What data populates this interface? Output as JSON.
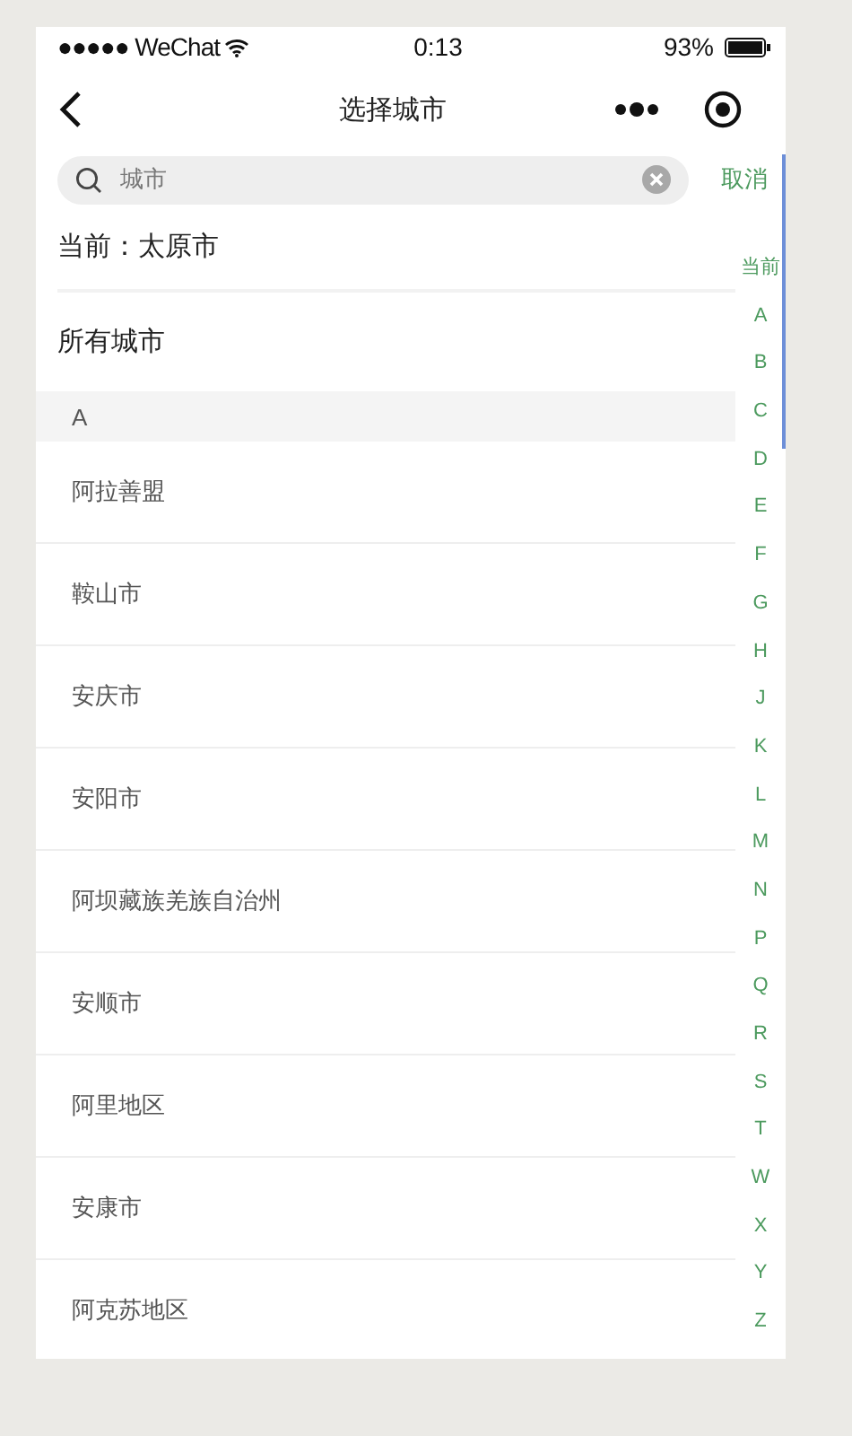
{
  "status_bar": {
    "carrier": "●●●●● WeChat",
    "time": "0:13",
    "battery": "93%"
  },
  "nav": {
    "title": "选择城市"
  },
  "search": {
    "value": "城市",
    "cancel": "取消"
  },
  "current": {
    "label": "当前：太原市"
  },
  "all_cities": {
    "label": "所有城市"
  },
  "sections": [
    {
      "letter": "A",
      "cities": [
        "阿拉善盟",
        "鞍山市",
        "安庆市",
        "安阳市",
        "阿坝藏族羌族自治州",
        "安顺市",
        "阿里地区",
        "安康市",
        "阿克苏地区"
      ]
    }
  ],
  "index": [
    "当前",
    "A",
    "B",
    "C",
    "D",
    "E",
    "F",
    "G",
    "H",
    "J",
    "K",
    "L",
    "M",
    "N",
    "P",
    "Q",
    "R",
    "S",
    "T",
    "W",
    "X",
    "Y",
    "Z"
  ]
}
